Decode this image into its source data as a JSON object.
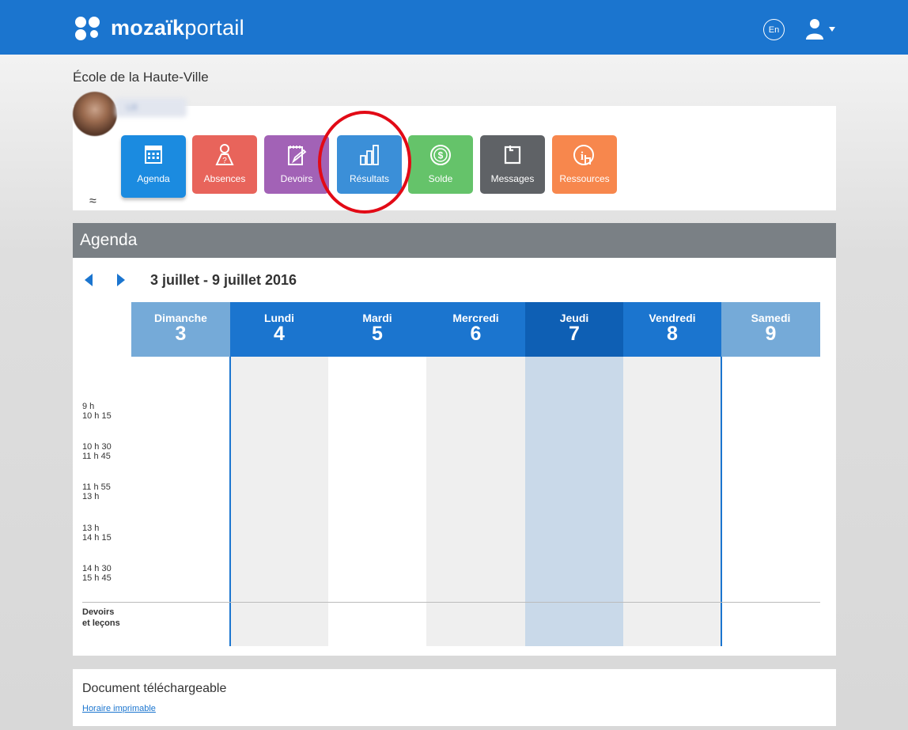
{
  "header": {
    "logo_bold": "mozaïk",
    "logo_light": "portail",
    "lang_label": "En",
    "brand_color": "#1b75cf"
  },
  "school": {
    "name": "École de la Haute-Ville"
  },
  "nav": {
    "tiles": [
      {
        "label": "Agenda",
        "icon": "calendar-icon",
        "color": "#1b8be0"
      },
      {
        "label": "Absences",
        "icon": "person-question-icon",
        "color": "#e8645b"
      },
      {
        "label": "Devoirs",
        "icon": "notepad-pencil-icon",
        "color": "#a262b6"
      },
      {
        "label": "Résultats",
        "icon": "bar-chart-icon",
        "color": "#3b8fd8"
      },
      {
        "label": "Solde",
        "icon": "dollar-coin-icon",
        "color": "#65c36a"
      },
      {
        "label": "Messages",
        "icon": "message-note-icon",
        "color": "#5f6266"
      },
      {
        "label": "Ressources",
        "icon": "info-hand-icon",
        "color": "#f7874d"
      }
    ],
    "collapse_glyph": "≈"
  },
  "agenda": {
    "title": "Agenda",
    "week_range": "3 juillet  - 9 juillet 2016",
    "days": [
      {
        "name": "Dimanche",
        "num": "3"
      },
      {
        "name": "Lundi",
        "num": "4"
      },
      {
        "name": "Mardi",
        "num": "5"
      },
      {
        "name": "Mercredi",
        "num": "6"
      },
      {
        "name": "Jeudi",
        "num": "7"
      },
      {
        "name": "Vendredi",
        "num": "8"
      },
      {
        "name": "Samedi",
        "num": "9"
      }
    ],
    "periods": [
      {
        "start": "9 h",
        "end": "10 h 15"
      },
      {
        "start": "10 h 30",
        "end": "11 h 45"
      },
      {
        "start": "11 h 55",
        "end": "13 h"
      },
      {
        "start": "13 h",
        "end": "14 h 15"
      },
      {
        "start": "14 h 30",
        "end": "15 h 45"
      }
    ],
    "homework_label_1": "Devoirs",
    "homework_label_2": "et leçons"
  },
  "downloads": {
    "title": "Document téléchargeable",
    "link": "Horaire imprimable"
  }
}
